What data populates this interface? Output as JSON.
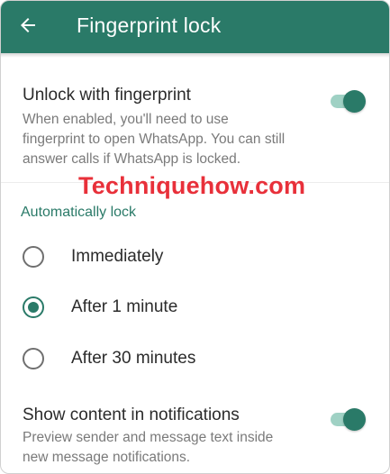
{
  "appbar": {
    "title": "Fingerprint lock",
    "back_icon": "arrow-left-icon",
    "background_color": "#2a7a68"
  },
  "fingerprint": {
    "title": "Unlock with fingerprint",
    "description_lines": [
      "When enabled, you'll need to use",
      "fingerprint to open WhatsApp. You can still",
      "answer calls if WhatsApp is locked."
    ],
    "enabled": true
  },
  "watermark": "Techniquehow.com",
  "auto_lock": {
    "header": "Automatically lock",
    "options": [
      {
        "label": "Immediately",
        "selected": false
      },
      {
        "label": "After 1 minute",
        "selected": true
      },
      {
        "label": "After 30 minutes",
        "selected": false
      }
    ]
  },
  "notifications": {
    "title": "Show content in notifications",
    "description_lines": [
      "Preview sender and message text inside",
      "new message notifications."
    ],
    "enabled": true
  },
  "colors": {
    "accent": "#2a7a68",
    "toggle_track": "#9fd1c4",
    "watermark": "#e8303a"
  }
}
